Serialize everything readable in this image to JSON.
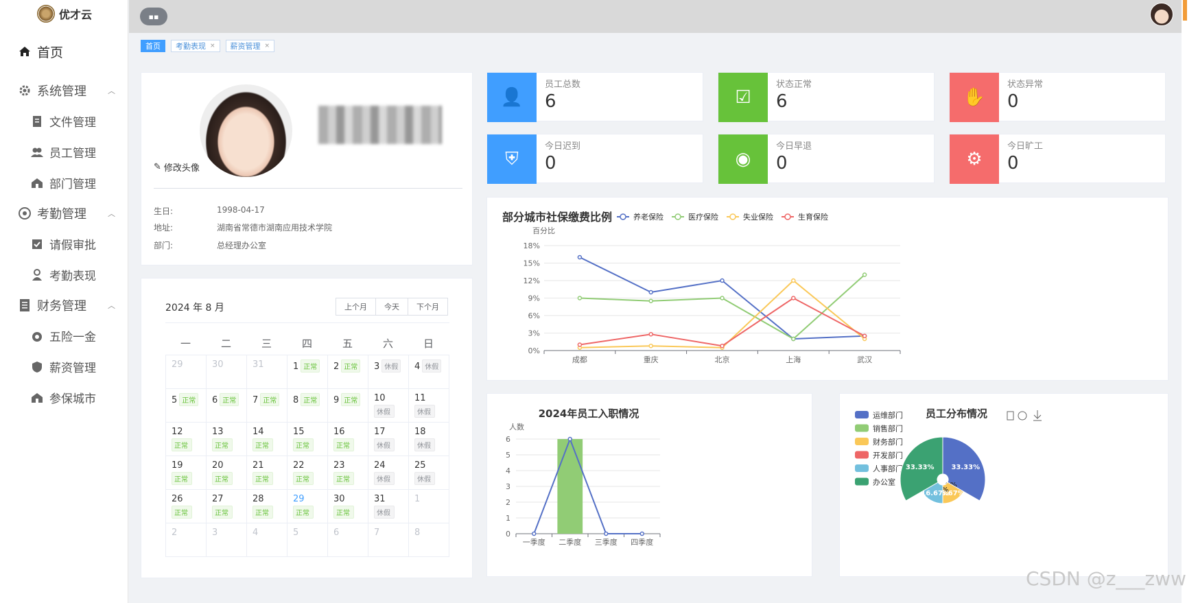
{
  "app": {
    "name": "优才云"
  },
  "sidebar": {
    "home": "首页",
    "groups": [
      {
        "label": "系统管理",
        "items": [
          "文件管理",
          "员工管理",
          "部门管理"
        ]
      },
      {
        "label": "考勤管理",
        "items": [
          "请假审批",
          "考勤表现"
        ]
      },
      {
        "label": "财务管理",
        "items": [
          "五险一金",
          "薪资管理",
          "参保城市"
        ]
      }
    ]
  },
  "tags": [
    {
      "label": "首页",
      "active": true
    },
    {
      "label": "考勤表现"
    },
    {
      "label": "薪资管理"
    }
  ],
  "profile": {
    "edit_avatar": "修改头像",
    "fields": [
      {
        "key": "生日:",
        "value": "1998-04-17"
      },
      {
        "key": "地址:",
        "value": "湖南省常德市湖南应用技术学院"
      },
      {
        "key": "部门:",
        "value": "总经理办公室"
      }
    ]
  },
  "stats": [
    {
      "label": "员工总数",
      "value": "6",
      "color": "#409eff",
      "icon": "user-icon"
    },
    {
      "label": "状态正常",
      "value": "6",
      "color": "#67c23a",
      "icon": "check-icon"
    },
    {
      "label": "状态异常",
      "value": "0",
      "color": "#f56c6c",
      "icon": "hand-icon"
    },
    {
      "label": "今日迟到",
      "value": "0",
      "color": "#409eff",
      "icon": "shield-icon"
    },
    {
      "label": "今日早退",
      "value": "0",
      "color": "#67c23a",
      "icon": "eye-icon"
    },
    {
      "label": "今日旷工",
      "value": "0",
      "color": "#f56c6c",
      "icon": "gear-icon"
    }
  ],
  "calendar": {
    "title": "2024 年 8 月",
    "buttons": [
      "上个月",
      "今天",
      "下个月"
    ],
    "weekdays": [
      "一",
      "二",
      "三",
      "四",
      "五",
      "六",
      "日"
    ],
    "status_ok": "正常",
    "status_rest": "休假",
    "days": [
      {
        "d": "29",
        "o": 1
      },
      {
        "d": "30",
        "o": 1
      },
      {
        "d": "31",
        "o": 1
      },
      {
        "d": "1",
        "s": "ok",
        "i": 1
      },
      {
        "d": "2",
        "s": "ok",
        "i": 1
      },
      {
        "d": "3",
        "s": "rest",
        "i": 1
      },
      {
        "d": "4",
        "s": "rest",
        "i": 1
      },
      {
        "d": "5",
        "s": "ok",
        "i": 1
      },
      {
        "d": "6",
        "s": "ok",
        "i": 1
      },
      {
        "d": "7",
        "s": "ok",
        "i": 1
      },
      {
        "d": "8",
        "s": "ok",
        "i": 1
      },
      {
        "d": "9",
        "s": "ok",
        "i": 1
      },
      {
        "d": "10",
        "s": "rest"
      },
      {
        "d": "11",
        "s": "rest"
      },
      {
        "d": "12",
        "s": "ok"
      },
      {
        "d": "13",
        "s": "ok"
      },
      {
        "d": "14",
        "s": "ok"
      },
      {
        "d": "15",
        "s": "ok"
      },
      {
        "d": "16",
        "s": "ok"
      },
      {
        "d": "17",
        "s": "rest"
      },
      {
        "d": "18",
        "s": "rest"
      },
      {
        "d": "19",
        "s": "ok"
      },
      {
        "d": "20",
        "s": "ok"
      },
      {
        "d": "21",
        "s": "ok"
      },
      {
        "d": "22",
        "s": "ok"
      },
      {
        "d": "23",
        "s": "ok"
      },
      {
        "d": "24",
        "s": "rest"
      },
      {
        "d": "25",
        "s": "rest"
      },
      {
        "d": "26",
        "s": "ok"
      },
      {
        "d": "27",
        "s": "ok"
      },
      {
        "d": "28",
        "s": "ok"
      },
      {
        "d": "29",
        "s": "ok",
        "t": 1
      },
      {
        "d": "30",
        "s": "ok"
      },
      {
        "d": "31",
        "s": "rest"
      },
      {
        "d": "1",
        "o": 1
      },
      {
        "d": "2",
        "o": 1
      },
      {
        "d": "3",
        "o": 1
      },
      {
        "d": "4",
        "o": 1
      },
      {
        "d": "5",
        "o": 1
      },
      {
        "d": "6",
        "o": 1
      },
      {
        "d": "7",
        "o": 1
      },
      {
        "d": "8",
        "o": 1
      }
    ]
  },
  "chart_data": [
    {
      "type": "line",
      "title": "部分城市社保缴费比例",
      "ylabel": "百分比",
      "categories": [
        "成都",
        "重庆",
        "北京",
        "上海",
        "武汉"
      ],
      "yticks": [
        "0%",
        "3%",
        "6%",
        "9%",
        "12%",
        "15%",
        "18%"
      ],
      "ylim": [
        0,
        18
      ],
      "legend_position": "top",
      "series": [
        {
          "name": "养老保险",
          "color": "#5470c6",
          "values": [
            16,
            10,
            12,
            2,
            2.5
          ]
        },
        {
          "name": "医疗保险",
          "color": "#91cc75",
          "values": [
            9,
            8.5,
            9,
            2,
            13
          ]
        },
        {
          "name": "失业保险",
          "color": "#fac858",
          "values": [
            0.5,
            0.8,
            0.5,
            12,
            2
          ]
        },
        {
          "name": "生育保险",
          "color": "#ee6666",
          "values": [
            1,
            2.8,
            0.8,
            9,
            2.5
          ]
        }
      ]
    },
    {
      "type": "bar",
      "title": "2024年员工入职情况",
      "ylabel": "人数",
      "categories": [
        "一季度",
        "二季度",
        "三季度",
        "四季度"
      ],
      "ylim": [
        0,
        6
      ],
      "yticks": [
        "0",
        "1",
        "2",
        "3",
        "4",
        "5",
        "6"
      ],
      "series": [
        {
          "type": "bar",
          "color": "#91cc75",
          "values": [
            0,
            6,
            0,
            0
          ]
        },
        {
          "type": "line",
          "color": "#5470c6",
          "values": [
            0,
            6,
            0,
            0
          ]
        }
      ]
    },
    {
      "type": "pie",
      "title": "员工分布情况",
      "legend_position": "left",
      "slices": [
        {
          "name": "运维部门",
          "value": 33.33,
          "label": "33.33%",
          "color": "#5470c6"
        },
        {
          "name": "销售部门",
          "value": 0,
          "label": "0%",
          "color": "#91cc75"
        },
        {
          "name": "财务部门",
          "value": 16.67,
          "label": "16.67%",
          "color": "#fac858"
        },
        {
          "name": "开发部门",
          "value": 0,
          "label": "0%",
          "color": "#ee6666"
        },
        {
          "name": "人事部门",
          "value": 16.67,
          "label": "16.67%",
          "color": "#73c0de"
        },
        {
          "name": "办公室",
          "value": 33.33,
          "label": "33.33%",
          "color": "#3ba272"
        }
      ]
    }
  ],
  "watermark": "CSDN @z___zww"
}
